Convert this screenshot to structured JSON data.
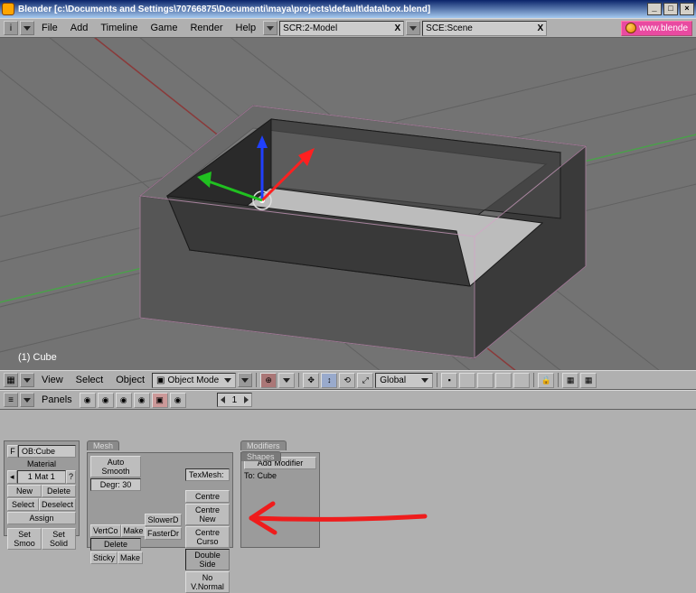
{
  "window": {
    "title": "Blender [c:\\Documents and Settings\\70766875\\Documenti\\maya\\projects\\default\\data\\box.blend]"
  },
  "header": {
    "menus": [
      "File",
      "Add",
      "Timeline",
      "Game",
      "Render",
      "Help"
    ],
    "screen_field": "SCR:2-Model",
    "scene_field": "SCE:Scene",
    "link_label": "www.blende"
  },
  "viewport": {
    "object_label": "(1) Cube"
  },
  "vp_header": {
    "menus": [
      "View",
      "Select",
      "Object"
    ],
    "mode": "Object Mode",
    "orient": "Global"
  },
  "panels_header": {
    "label": "Panels",
    "page": "1"
  },
  "link_mat": {
    "ob_label": "F",
    "ob_field": "OB:Cube",
    "section": "Material",
    "mat_field": "1 Mat 1",
    "new": "New",
    "delete": "Delete",
    "select": "Select",
    "deselect": "Deselect",
    "assign": "Assign",
    "set_smooth": "Set Smoo",
    "set_solid": "Set Solid"
  },
  "mesh": {
    "tab": "Mesh",
    "auto_smooth": "Auto Smooth",
    "degr": "Degr: 30",
    "vertcol": "VertCo",
    "sticky": "Sticky",
    "make1": "Make",
    "make2": "Make",
    "delete": "Delete",
    "slower": "SlowerD",
    "faster": "FasterDr",
    "texmesh": "TexMesh:",
    "centre": "Centre",
    "centre_new": "Centre New",
    "centre_cursor": "Centre Curso",
    "double_sided": "Double Side",
    "no_vnormal": "No V.Normal"
  },
  "modifiers": {
    "tab": "Modifiers",
    "shapes_tab": "Shapes",
    "add": "Add Modifier",
    "to": "To: Cube"
  }
}
